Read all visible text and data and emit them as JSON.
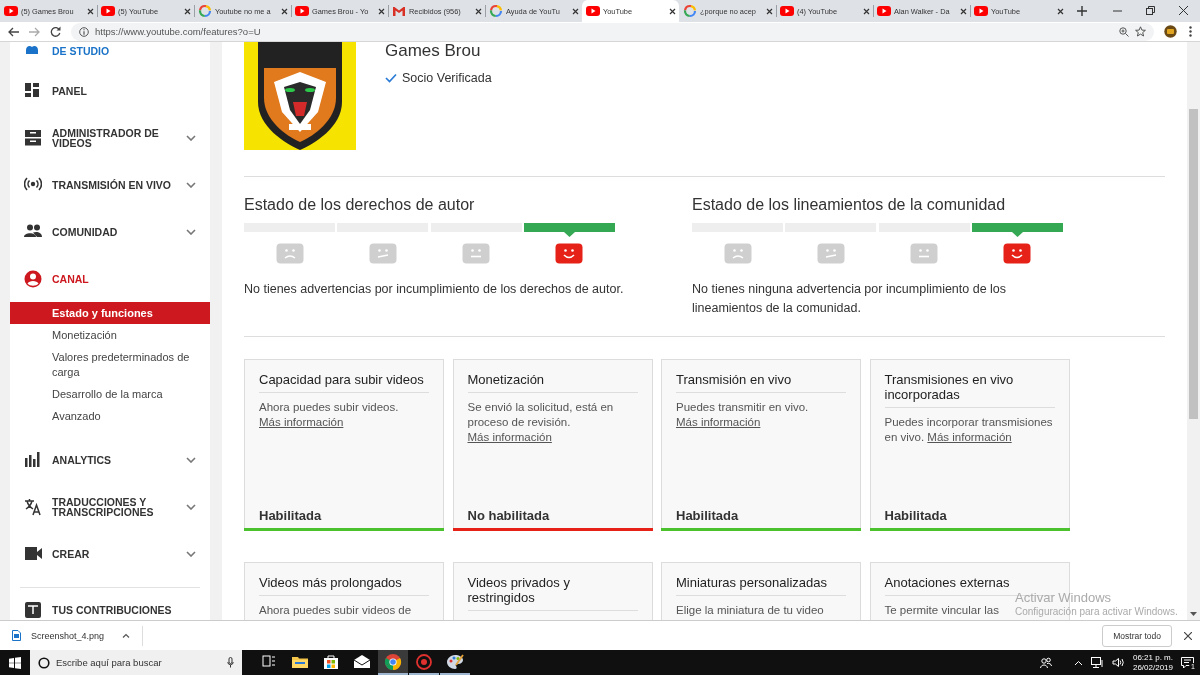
{
  "browser": {
    "tabs": [
      {
        "kind": "youtube",
        "title": "(5) Games Brou",
        "selected": false
      },
      {
        "kind": "youtube",
        "title": "(5) YouTube",
        "selected": false
      },
      {
        "kind": "google",
        "title": "Youtube no me a",
        "selected": false
      },
      {
        "kind": "youtube",
        "title": "Games Brou - Yo",
        "selected": false
      },
      {
        "kind": "gmail",
        "title": "Recibidos (956)",
        "selected": false
      },
      {
        "kind": "google",
        "title": "Ayuda de YouTu",
        "selected": false
      },
      {
        "kind": "youtube",
        "title": "YouTube",
        "selected": true
      },
      {
        "kind": "google",
        "title": "¿porque no acep",
        "selected": false
      },
      {
        "kind": "youtube",
        "title": "(4) YouTube",
        "selected": false
      },
      {
        "kind": "youtube",
        "title": "Alan Walker - Da",
        "selected": false
      },
      {
        "kind": "youtube",
        "title": "YouTube",
        "selected": false
      }
    ],
    "url": "https://www.youtube.com/features?o=U"
  },
  "sidebar": {
    "items": [
      {
        "kind": "link",
        "label": "DE STUDIO",
        "expandable": false,
        "selected": false
      },
      {
        "kind": "section",
        "label": "PANEL",
        "expandable": false,
        "selected": false
      },
      {
        "kind": "section",
        "label": "ADMINISTRADOR DE VIDEOS",
        "expandable": true,
        "selected": false
      },
      {
        "kind": "section",
        "label": "TRANSMISIÓN EN VIVO",
        "expandable": true,
        "selected": false
      },
      {
        "kind": "section",
        "label": "COMUNIDAD",
        "expandable": true,
        "selected": false
      },
      {
        "kind": "section",
        "label": "CANAL",
        "expandable": false,
        "selected": true,
        "children": [
          {
            "label": "Estado y funciones",
            "selected": true
          },
          {
            "label": "Monetización",
            "selected": false
          },
          {
            "label": "Valores predeterminados de carga",
            "selected": false
          },
          {
            "label": "Desarrollo de la marca",
            "selected": false
          },
          {
            "label": "Avanzado",
            "selected": false
          }
        ]
      },
      {
        "kind": "section",
        "label": "ANALYTICS",
        "expandable": true,
        "selected": false
      },
      {
        "kind": "section",
        "label": "TRADUCCIONES Y TRANSCRIPCIONES",
        "expandable": true,
        "selected": false
      },
      {
        "kind": "section",
        "label": "CREAR",
        "expandable": true,
        "selected": false
      },
      {
        "kind": "section",
        "label": "TUS CONTRIBUCIONES",
        "expandable": false,
        "selected": false
      }
    ]
  },
  "channel": {
    "name": "Games Brou",
    "badge": "Socio Verificada"
  },
  "status_sections": [
    {
      "title": "Estado de los derechos de autor",
      "segments": [
        {
          "selected": false
        },
        {
          "selected": false
        },
        {
          "selected": false
        },
        {
          "selected": true
        }
      ],
      "message": "No tienes advertencias por incumplimiento de los derechos de autor."
    },
    {
      "title": "Estado de los lineamientos de la comunidad",
      "segments": [
        {
          "selected": false
        },
        {
          "selected": false
        },
        {
          "selected": false
        },
        {
          "selected": true
        }
      ],
      "message": "No tienes ninguna advertencia por incumplimiento de los lineamientos de la comunidad."
    }
  ],
  "features": [
    {
      "title": "Capacidad para subir videos",
      "description": "Ahora puedes subir videos.",
      "link": "Más información",
      "status": "Habilitada",
      "enabled": true
    },
    {
      "title": "Monetización",
      "description": "Se envió la solicitud, está en proceso de revisión.",
      "link": "Más información",
      "status": "No habilitada",
      "enabled": false
    },
    {
      "title": "Transmisión en vivo",
      "description": "Puedes transmitir en vivo.",
      "link": "Más información",
      "status": "Habilitada",
      "enabled": true
    },
    {
      "title": "Transmisiones en vivo incorporadas",
      "description": "Puedes incorporar transmisiones en vivo.",
      "link": "Más información",
      "status": "Habilitada",
      "enabled": true
    },
    {
      "title": "Videos más prolongados",
      "description": "Ahora puedes subir videos de"
    },
    {
      "title": "Videos privados y restringidos"
    },
    {
      "title": "Miniaturas personalizadas",
      "description": "Elige la miniatura de tu video"
    },
    {
      "title": "Anotaciones externas",
      "description": "Te permite vincular las"
    }
  ],
  "activation": {
    "title": "Activar Windows",
    "message": "Configuración para activar Windows."
  },
  "downloads": {
    "items": [
      {
        "name": "Screenshot_4.png"
      }
    ],
    "show_all": "Mostrar todo"
  },
  "taskbar": {
    "search_placeholder": "Escribe aquí para buscar",
    "apps": [
      {
        "kind": "task-view",
        "running": false,
        "active": false
      },
      {
        "kind": "explorer",
        "running": false,
        "active": false
      },
      {
        "kind": "store",
        "running": false,
        "active": false
      },
      {
        "kind": "mail",
        "running": false,
        "active": false
      },
      {
        "kind": "chrome",
        "running": true,
        "active": true
      },
      {
        "kind": "recorder",
        "running": true,
        "active": false
      },
      {
        "kind": "paint",
        "running": true,
        "active": false
      }
    ],
    "time": "06:21 p. m.",
    "date": "26/02/2019",
    "notifications": "1"
  }
}
